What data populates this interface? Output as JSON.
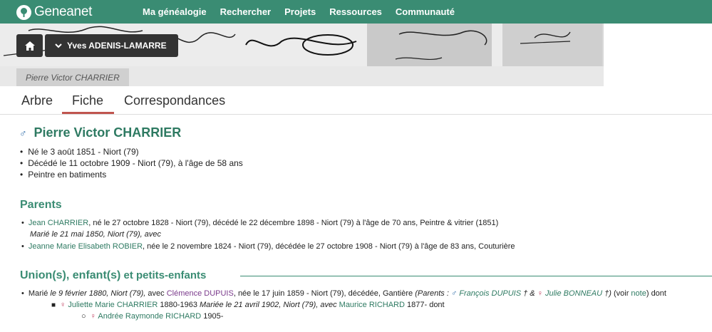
{
  "header": {
    "brand": "Geneanet",
    "nav": [
      "Ma généalogie",
      "Rechercher",
      "Projets",
      "Ressources",
      "Communauté"
    ]
  },
  "toolbar": {
    "user_label": "Yves ADENIS-LAMARRE"
  },
  "breadcrumb": {
    "current": "Pierre Victor CHARRIER"
  },
  "tabs": [
    {
      "label": "Arbre"
    },
    {
      "label": "Fiche"
    },
    {
      "label": "Correspondances"
    }
  ],
  "active_tab": "Fiche",
  "person": {
    "gender_symbol": "♂",
    "name": "Pierre Victor CHARRIER",
    "facts": [
      "Né le 3 août 1851 - Niort (79)",
      "Décédé le 11 octobre 1909 - Niort (79), à l'âge de 58 ans",
      "Peintre en batiments"
    ]
  },
  "parents": {
    "title": "Parents",
    "father_name": "Jean CHARRIER",
    "father_details": ", né le 27 octobre 1828 - Niort (79), décédé le 22 décembre 1898 - Niort (79) à l'âge de 70 ans, Peintre & vitrier (1851)",
    "marriage": "Marié le 21 mai 1850, Niort (79), avec",
    "mother_name": "Jeanne Marie Elisabeth ROBIER",
    "mother_details": ", née le 2 novembre 1824 - Niort (79), décédée le 27 octobre 1908 - Niort (79) à l'âge de 83 ans, Couturière"
  },
  "unions": {
    "title_bold": "Union(s), enfant(s)",
    "title_rest": " et petits-enfants",
    "marie_label": "Marié",
    "marriage_date": " le 9 février 1880, Niort (79),",
    "avec": " avec ",
    "spouse_name": "Clémence DUPUIS",
    "spouse_details": ", née le 17 juin 1859 - Niort (79), décédée, Gantière ",
    "parents_open": "(Parents : ",
    "spouse_father": "François DUPUIS",
    "father_dagger": " † & ",
    "spouse_mother": "Julie BONNEAU",
    "parents_close": " †)",
    "voir_open": " (voir ",
    "note_link": "note",
    "voir_close": ") dont",
    "child_name": "Juliette Marie CHARRIER",
    "child_years": " 1880-1963 ",
    "child_marriage": " Mariée le 21 avril 1902, Niort (79), avec ",
    "child_spouse": "Maurice RICHARD",
    "child_spouse_years": " 1877- dont",
    "grandchild_name": "Andrée Raymonde RICHARD",
    "grandchild_years": " 1905-"
  }
}
